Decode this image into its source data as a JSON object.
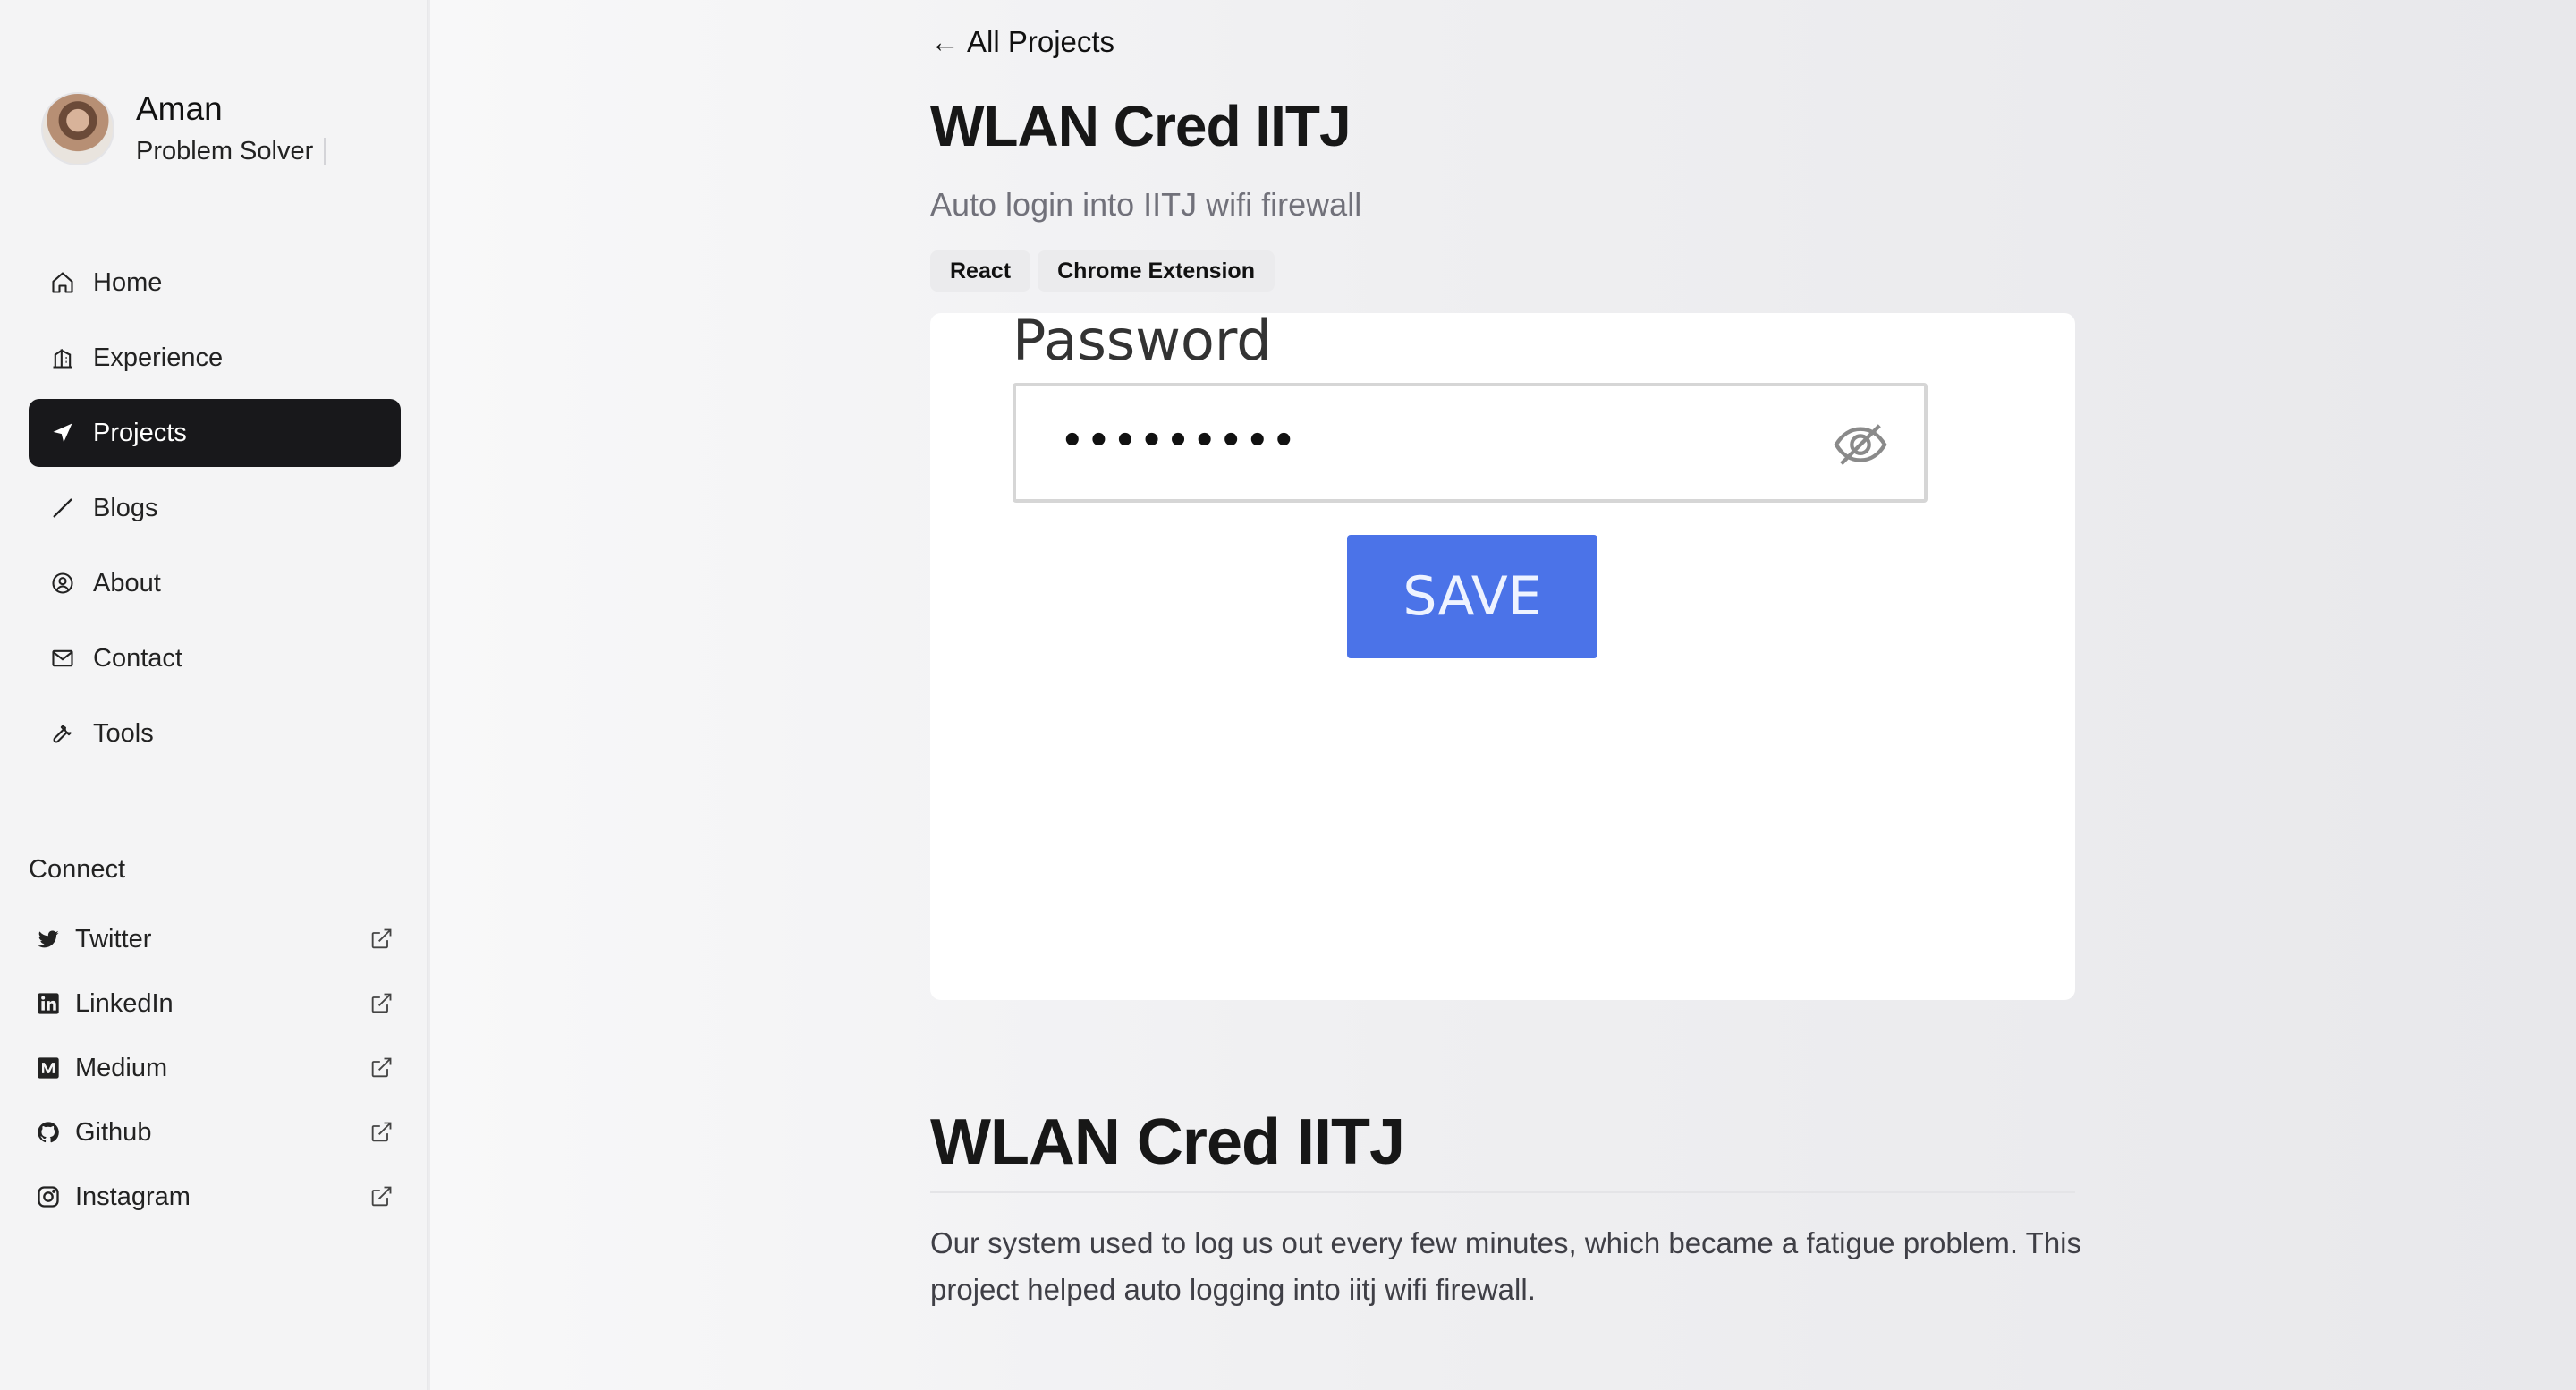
{
  "profile": {
    "name": "Aman",
    "role": "Problem Solver"
  },
  "nav": {
    "items": [
      {
        "label": "Home",
        "icon": "home-icon"
      },
      {
        "label": "Experience",
        "icon": "building-icon"
      },
      {
        "label": "Projects",
        "icon": "navigation-arrow-icon",
        "active": true
      },
      {
        "label": "Blogs",
        "icon": "pencil-icon"
      },
      {
        "label": "About",
        "icon": "user-circle-icon"
      },
      {
        "label": "Contact",
        "icon": "mail-icon"
      },
      {
        "label": "Tools",
        "icon": "wrench-icon"
      }
    ]
  },
  "connect": {
    "title": "Connect",
    "items": [
      {
        "label": "Twitter",
        "icon": "twitter-icon"
      },
      {
        "label": "LinkedIn",
        "icon": "linkedin-icon"
      },
      {
        "label": "Medium",
        "icon": "medium-icon"
      },
      {
        "label": "Github",
        "icon": "github-icon"
      },
      {
        "label": "Instagram",
        "icon": "instagram-icon"
      }
    ]
  },
  "main": {
    "back_arrow": "←",
    "back_label": "All Projects",
    "title": "WLAN Cred IITJ",
    "subtitle": "Auto login into IITJ wifi firewall",
    "tags": [
      "React",
      "Chrome Extension"
    ],
    "hero": {
      "password_label": "Password",
      "password_value": "•••••••••",
      "save_label": "SAVE"
    },
    "section_title": "WLAN Cred IITJ",
    "body": "Our system used to log us out every few minutes, which became a fatigue problem. This project helped auto logging into iitj wifi firewall."
  },
  "colors": {
    "active_nav_bg": "#18181b",
    "save_button": "#4b73e8",
    "subtitle": "#71717a"
  }
}
